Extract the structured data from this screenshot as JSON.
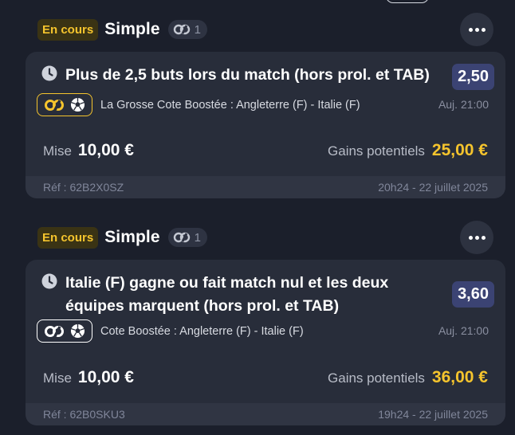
{
  "bets": [
    {
      "status": "En cours",
      "type": "Simple",
      "combo_count": "1",
      "selection": "Plus de 2,5 buts lors du match (hors prol. et TAB)",
      "odds": "2,50",
      "boost_style": "yellow",
      "match": "La Grosse Cote Boostée : Angleterre (F) - Italie (F)",
      "time": "Auj. 21:00",
      "stake_label": "Mise",
      "stake": "10,00 €",
      "gains_label": "Gains potentiels",
      "gains": "25,00 €",
      "ref": "Réf : 62B2X0SZ",
      "date": "20h24 - 22 juillet 2025"
    },
    {
      "status": "En cours",
      "type": "Simple",
      "combo_count": "1",
      "selection": "Italie (F) gagne ou fait match nul et les deux équipes marquent (hors prol. et TAB)",
      "odds": "3,60",
      "boost_style": "white",
      "match": "Cote Boostée : Angleterre (F) - Italie (F)",
      "time": "Auj. 21:00",
      "stake_label": "Mise",
      "stake": "10,00 €",
      "gains_label": "Gains potentiels",
      "gains": "36,00 €",
      "ref": "Réf : 62B0SKU3",
      "date": "19h24 - 22 juillet 2025"
    }
  ],
  "colors": {
    "accent": "#f5c42d",
    "odds_bg": "#3b4373",
    "card_bg": "#282d3a",
    "page_bg": "#1b1f2b"
  },
  "icons": [
    "clock-icon",
    "combo-icon",
    "boost-icon",
    "soccer-ball-icon",
    "more-options-icon"
  ]
}
